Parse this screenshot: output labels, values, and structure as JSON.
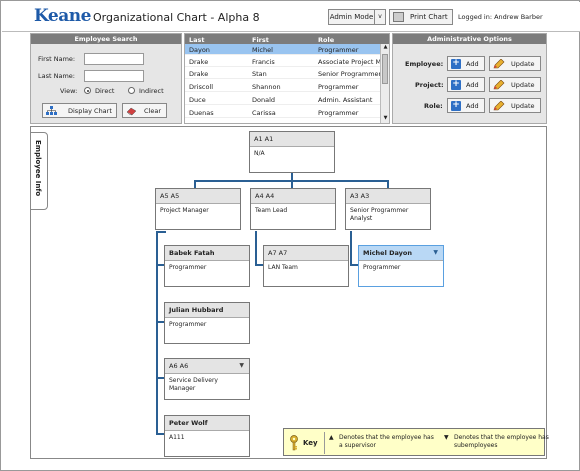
{
  "header": {
    "logo": "Keane",
    "title": "Organizational Chart - Alpha 8",
    "admin_mode_label": "Admin Mode",
    "admin_mode_arrow": "v",
    "print_label": "Print Chart",
    "logged_in": "Logged in: Andrew Barber"
  },
  "employee_search": {
    "title": "Employee Search",
    "first_name_label": "First Name:",
    "last_name_label": "Last Name:",
    "first_name_value": "",
    "last_name_value": "",
    "view_label": "View:",
    "direct_label": "Direct",
    "indirect_label": "Indirect",
    "display_chart_label": "Display Chart",
    "clear_label": "Clear"
  },
  "employee_list": {
    "columns": [
      "Last",
      "First",
      "Role"
    ],
    "rows": [
      {
        "last": "Dayon",
        "first": "Michel",
        "role": "Programmer"
      },
      {
        "last": "Drake",
        "first": "Francis",
        "role": "Associate Project Ma"
      },
      {
        "last": "Drake",
        "first": "Stan",
        "role": "Senior Programmer"
      },
      {
        "last": "Driscoll",
        "first": "Shannon",
        "role": "Programmer"
      },
      {
        "last": "Duce",
        "first": "Donald",
        "role": "Admin. Assistant"
      },
      {
        "last": "Duenas",
        "first": "Carissa",
        "role": "Programmer"
      }
    ],
    "selected_index": 0,
    "scroll_up": "▲",
    "scroll_down": "▼"
  },
  "admin_options": {
    "title": "Administrative Options",
    "rows": [
      {
        "label": "Employee:",
        "add": "Add",
        "update": "Update"
      },
      {
        "label": "Project:",
        "add": "Add",
        "update": "Update"
      },
      {
        "label": "Role:",
        "add": "Add",
        "update": "Update"
      }
    ]
  },
  "side_tab": "Employee Info",
  "org_chart": {
    "root": {
      "name": "A1 A1",
      "role": "N/A"
    },
    "level2": [
      {
        "name": "A5 A5",
        "role": "Project Manager"
      },
      {
        "name": "A4 A4",
        "role": "Team Lead"
      },
      {
        "name": "A3 A3",
        "role": "Senior Programmer Analyst"
      }
    ],
    "col1": [
      {
        "name": "Babek Fatah",
        "role": "Programmer"
      },
      {
        "name": "Julian Hubbard",
        "role": "Programmer"
      },
      {
        "name": "A6 A6",
        "role": "Service Delivery Manager",
        "arrow": "▼"
      },
      {
        "name": "Peter Wolf",
        "role": "A111"
      }
    ],
    "col2": [
      {
        "name": "A7 A7",
        "role": "LAN Team"
      }
    ],
    "col3": [
      {
        "name": "Michel Dayon",
        "role": "Programmer",
        "arrow": "▼"
      }
    ]
  },
  "key": {
    "label": "Key",
    "item1_symbol": "▲",
    "item1_text": "Denotes that the employee has a supervisor",
    "item2_symbol": "▼",
    "item2_text": "Denotes that the employee has subemployees"
  }
}
